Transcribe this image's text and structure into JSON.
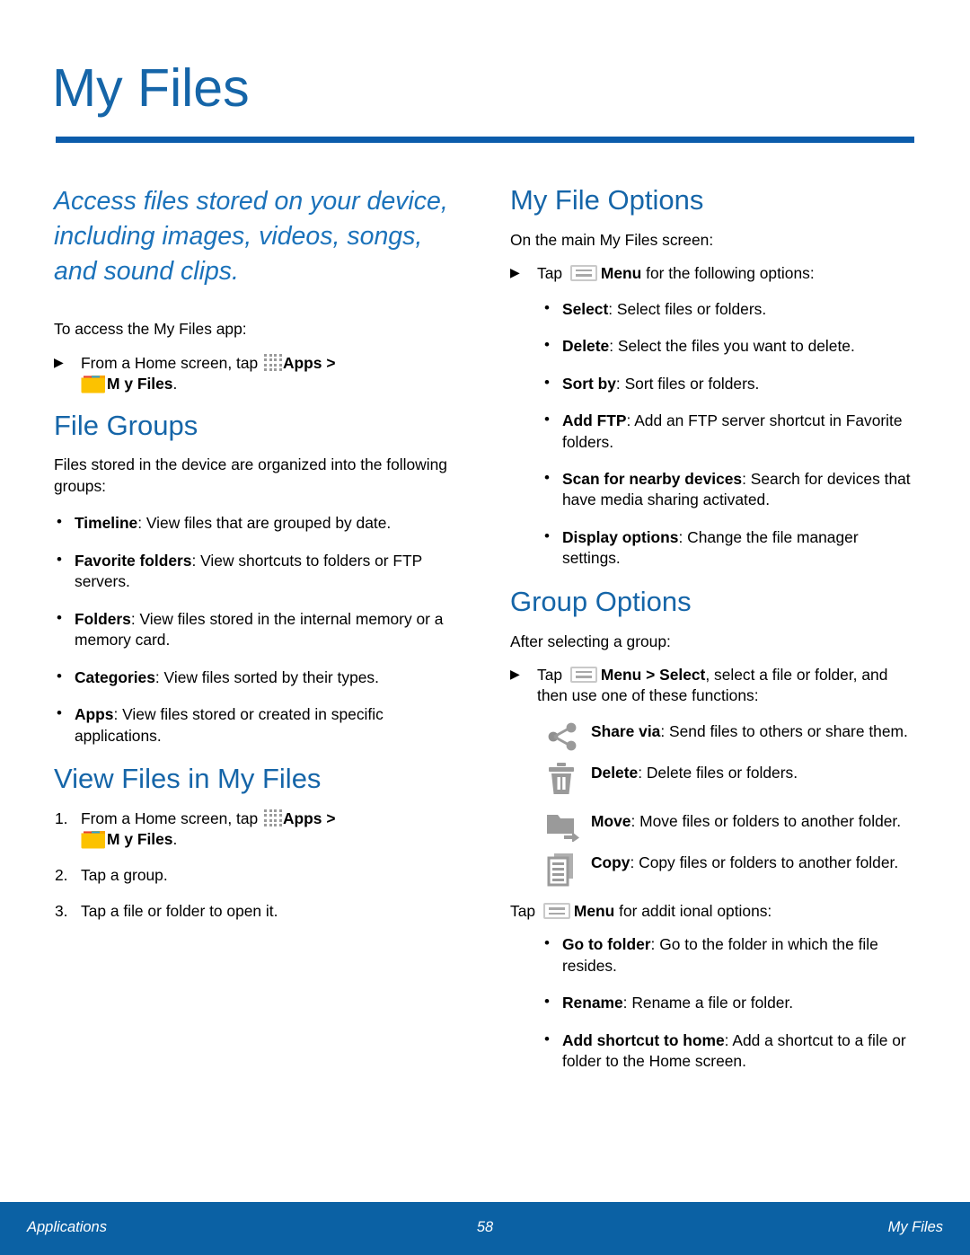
{
  "page": {
    "title": "My Files",
    "accent_blue": "#1565a8",
    "rule_blue": "#0b5cab",
    "footer_blue": "#0b61a4"
  },
  "left_column": {
    "lede": "Access files stored on your device, including images, videos, songs, and sound clips.",
    "intro_line": "To access the My Files app:",
    "access_step": {
      "marker": "▶",
      "text_before_apps": "From a Home screen, tap ",
      "apps_label": "Apps",
      "separator": " > ",
      "my_files_label": "M y Files",
      "period": "."
    },
    "file_groups": {
      "heading": "File Groups",
      "intro": "Files stored in the device are organized into the following groups:",
      "bullets": [
        {
          "term": "Timeline",
          "desc": ": View files that are grouped by date."
        },
        {
          "term": "Favorite folders",
          "desc": ": View shortcuts to folders or FTP servers."
        },
        {
          "term": "Folders",
          "desc": ": View files stored in the internal memory or a memory card."
        },
        {
          "term": "Categories",
          "desc": ": View files sorted by their types."
        },
        {
          "term": "Apps",
          "desc": ": View files stored or created in specific applications."
        }
      ]
    },
    "view_files": {
      "heading": "View Files in My Files",
      "step1": {
        "marker": "1.",
        "text_before_apps": "From a Home screen, tap ",
        "apps_label": "Apps",
        "separator": " > ",
        "my_files_label": "M y Files",
        "period": "."
      },
      "step2": {
        "marker": "2.",
        "text": "Tap a group."
      },
      "step3": {
        "marker": "3.",
        "text": "Tap a file or folder to open it."
      }
    }
  },
  "right_column": {
    "my_file_options": {
      "heading": "My File Options",
      "intro": "On the main My Files screen:",
      "tap_step": {
        "marker": "▶",
        "text_before_icon": "Tap ",
        "menu_label": "Menu",
        "text_after": " for the following options:"
      },
      "bullets": [
        {
          "term": "Select",
          "desc": ": Select files or folders."
        },
        {
          "term": "Delete",
          "desc": ": Select the files you want to delete."
        },
        {
          "term": "Sort by",
          "desc": ": Sort files or folders."
        },
        {
          "term": "Add FTP",
          "desc": ": Add an FTP server shortcut in Favorite folders."
        },
        {
          "term": "Scan for nearby devices",
          "desc": ": Search for devices that have media sharing activated."
        },
        {
          "term": "Display options",
          "desc": ": Change the file manager settings."
        }
      ]
    },
    "group_options": {
      "heading": "Group Options",
      "intro": "After selecting a group:",
      "tap_step": {
        "marker": "▶",
        "text_before_icon": "Tap ",
        "menu_label": "Menu",
        "arrow": " > ",
        "select_label": "Select",
        "text_after": ", select a file or folder, and then use one of these functions:"
      },
      "functions": [
        {
          "icon": "share-icon",
          "term": "Share via",
          "desc": ": Send files to others or share them."
        },
        {
          "icon": "trash-icon",
          "term": "Delete",
          "desc": ": Delete files or folders."
        },
        {
          "icon": "move-folder-icon",
          "term": "Move",
          "desc": ": Move files or folders to another folder."
        },
        {
          "icon": "copy-icon",
          "term": "Copy",
          "desc": ": Copy files or folders to another folder."
        }
      ],
      "additional_tap": {
        "text_before_icon": "Tap ",
        "menu_label": "Menu",
        "text_after": " for addit ional options:"
      },
      "additional_bullets": [
        {
          "term": "Go to folder",
          "desc": ": Go to the folder in which the file resides."
        },
        {
          "term": "Rename",
          "desc": ": Rename a file or folder."
        },
        {
          "term": "Add shortcut to home",
          "desc": ": Add a shortcut to a file or folder to the Home screen."
        }
      ]
    }
  },
  "footer": {
    "left": "Applications",
    "page_number": "58",
    "right": "My Files"
  }
}
